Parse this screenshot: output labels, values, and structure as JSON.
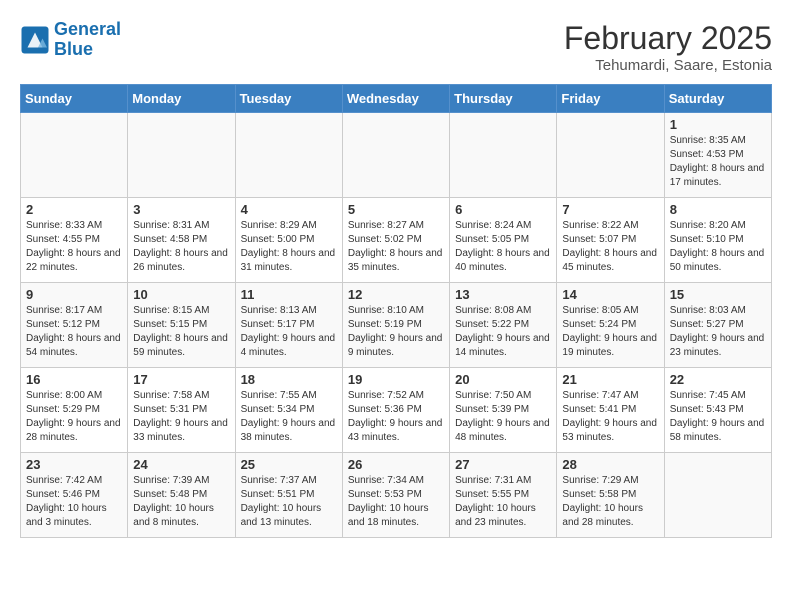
{
  "logo": {
    "text_general": "General",
    "text_blue": "Blue"
  },
  "title": "February 2025",
  "subtitle": "Tehumardi, Saare, Estonia",
  "headers": [
    "Sunday",
    "Monday",
    "Tuesday",
    "Wednesday",
    "Thursday",
    "Friday",
    "Saturday"
  ],
  "weeks": [
    [
      {
        "day": "",
        "sunrise": "",
        "sunset": "",
        "daylight": ""
      },
      {
        "day": "",
        "sunrise": "",
        "sunset": "",
        "daylight": ""
      },
      {
        "day": "",
        "sunrise": "",
        "sunset": "",
        "daylight": ""
      },
      {
        "day": "",
        "sunrise": "",
        "sunset": "",
        "daylight": ""
      },
      {
        "day": "",
        "sunrise": "",
        "sunset": "",
        "daylight": ""
      },
      {
        "day": "",
        "sunrise": "",
        "sunset": "",
        "daylight": ""
      },
      {
        "day": "1",
        "sunrise": "Sunrise: 8:35 AM",
        "sunset": "Sunset: 4:53 PM",
        "daylight": "Daylight: 8 hours and 17 minutes."
      }
    ],
    [
      {
        "day": "2",
        "sunrise": "Sunrise: 8:33 AM",
        "sunset": "Sunset: 4:55 PM",
        "daylight": "Daylight: 8 hours and 22 minutes."
      },
      {
        "day": "3",
        "sunrise": "Sunrise: 8:31 AM",
        "sunset": "Sunset: 4:58 PM",
        "daylight": "Daylight: 8 hours and 26 minutes."
      },
      {
        "day": "4",
        "sunrise": "Sunrise: 8:29 AM",
        "sunset": "Sunset: 5:00 PM",
        "daylight": "Daylight: 8 hours and 31 minutes."
      },
      {
        "day": "5",
        "sunrise": "Sunrise: 8:27 AM",
        "sunset": "Sunset: 5:02 PM",
        "daylight": "Daylight: 8 hours and 35 minutes."
      },
      {
        "day": "6",
        "sunrise": "Sunrise: 8:24 AM",
        "sunset": "Sunset: 5:05 PM",
        "daylight": "Daylight: 8 hours and 40 minutes."
      },
      {
        "day": "7",
        "sunrise": "Sunrise: 8:22 AM",
        "sunset": "Sunset: 5:07 PM",
        "daylight": "Daylight: 8 hours and 45 minutes."
      },
      {
        "day": "8",
        "sunrise": "Sunrise: 8:20 AM",
        "sunset": "Sunset: 5:10 PM",
        "daylight": "Daylight: 8 hours and 50 minutes."
      }
    ],
    [
      {
        "day": "9",
        "sunrise": "Sunrise: 8:17 AM",
        "sunset": "Sunset: 5:12 PM",
        "daylight": "Daylight: 8 hours and 54 minutes."
      },
      {
        "day": "10",
        "sunrise": "Sunrise: 8:15 AM",
        "sunset": "Sunset: 5:15 PM",
        "daylight": "Daylight: 8 hours and 59 minutes."
      },
      {
        "day": "11",
        "sunrise": "Sunrise: 8:13 AM",
        "sunset": "Sunset: 5:17 PM",
        "daylight": "Daylight: 9 hours and 4 minutes."
      },
      {
        "day": "12",
        "sunrise": "Sunrise: 8:10 AM",
        "sunset": "Sunset: 5:19 PM",
        "daylight": "Daylight: 9 hours and 9 minutes."
      },
      {
        "day": "13",
        "sunrise": "Sunrise: 8:08 AM",
        "sunset": "Sunset: 5:22 PM",
        "daylight": "Daylight: 9 hours and 14 minutes."
      },
      {
        "day": "14",
        "sunrise": "Sunrise: 8:05 AM",
        "sunset": "Sunset: 5:24 PM",
        "daylight": "Daylight: 9 hours and 19 minutes."
      },
      {
        "day": "15",
        "sunrise": "Sunrise: 8:03 AM",
        "sunset": "Sunset: 5:27 PM",
        "daylight": "Daylight: 9 hours and 23 minutes."
      }
    ],
    [
      {
        "day": "16",
        "sunrise": "Sunrise: 8:00 AM",
        "sunset": "Sunset: 5:29 PM",
        "daylight": "Daylight: 9 hours and 28 minutes."
      },
      {
        "day": "17",
        "sunrise": "Sunrise: 7:58 AM",
        "sunset": "Sunset: 5:31 PM",
        "daylight": "Daylight: 9 hours and 33 minutes."
      },
      {
        "day": "18",
        "sunrise": "Sunrise: 7:55 AM",
        "sunset": "Sunset: 5:34 PM",
        "daylight": "Daylight: 9 hours and 38 minutes."
      },
      {
        "day": "19",
        "sunrise": "Sunrise: 7:52 AM",
        "sunset": "Sunset: 5:36 PM",
        "daylight": "Daylight: 9 hours and 43 minutes."
      },
      {
        "day": "20",
        "sunrise": "Sunrise: 7:50 AM",
        "sunset": "Sunset: 5:39 PM",
        "daylight": "Daylight: 9 hours and 48 minutes."
      },
      {
        "day": "21",
        "sunrise": "Sunrise: 7:47 AM",
        "sunset": "Sunset: 5:41 PM",
        "daylight": "Daylight: 9 hours and 53 minutes."
      },
      {
        "day": "22",
        "sunrise": "Sunrise: 7:45 AM",
        "sunset": "Sunset: 5:43 PM",
        "daylight": "Daylight: 9 hours and 58 minutes."
      }
    ],
    [
      {
        "day": "23",
        "sunrise": "Sunrise: 7:42 AM",
        "sunset": "Sunset: 5:46 PM",
        "daylight": "Daylight: 10 hours and 3 minutes."
      },
      {
        "day": "24",
        "sunrise": "Sunrise: 7:39 AM",
        "sunset": "Sunset: 5:48 PM",
        "daylight": "Daylight: 10 hours and 8 minutes."
      },
      {
        "day": "25",
        "sunrise": "Sunrise: 7:37 AM",
        "sunset": "Sunset: 5:51 PM",
        "daylight": "Daylight: 10 hours and 13 minutes."
      },
      {
        "day": "26",
        "sunrise": "Sunrise: 7:34 AM",
        "sunset": "Sunset: 5:53 PM",
        "daylight": "Daylight: 10 hours and 18 minutes."
      },
      {
        "day": "27",
        "sunrise": "Sunrise: 7:31 AM",
        "sunset": "Sunset: 5:55 PM",
        "daylight": "Daylight: 10 hours and 23 minutes."
      },
      {
        "day": "28",
        "sunrise": "Sunrise: 7:29 AM",
        "sunset": "Sunset: 5:58 PM",
        "daylight": "Daylight: 10 hours and 28 minutes."
      },
      {
        "day": "",
        "sunrise": "",
        "sunset": "",
        "daylight": ""
      }
    ]
  ]
}
